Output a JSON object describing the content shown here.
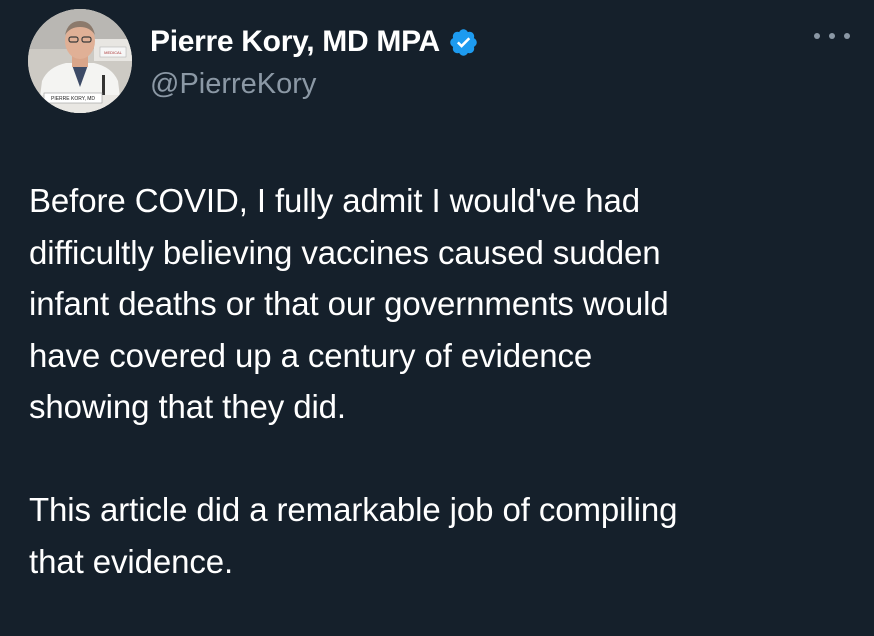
{
  "author": {
    "display_name": "Pierre Kory, MD MPA",
    "handle": "@PierreKory",
    "verified": true,
    "avatar_name_card": "PIERRE KORY, MD",
    "avatar_sign": "MEDICAL"
  },
  "tweet": {
    "paragraphs": [
      {
        "lines": [
          "Before COVID, I fully admit I would've had",
          "difficultly believing vaccines caused sudden",
          "infant deaths or that our governments would",
          "have covered up a century of evidence",
          "showing that they did."
        ]
      },
      {
        "lines": [
          "This article did a remarkable job of compiling",
          "that evidence."
        ]
      }
    ]
  },
  "colors": {
    "background": "#15202b",
    "text": "#ffffff",
    "secondary_text": "#8b98a5",
    "verified_blue": "#1d9bf0"
  },
  "icons": {
    "verified": "verified-badge-icon",
    "more": "more-options-icon"
  }
}
